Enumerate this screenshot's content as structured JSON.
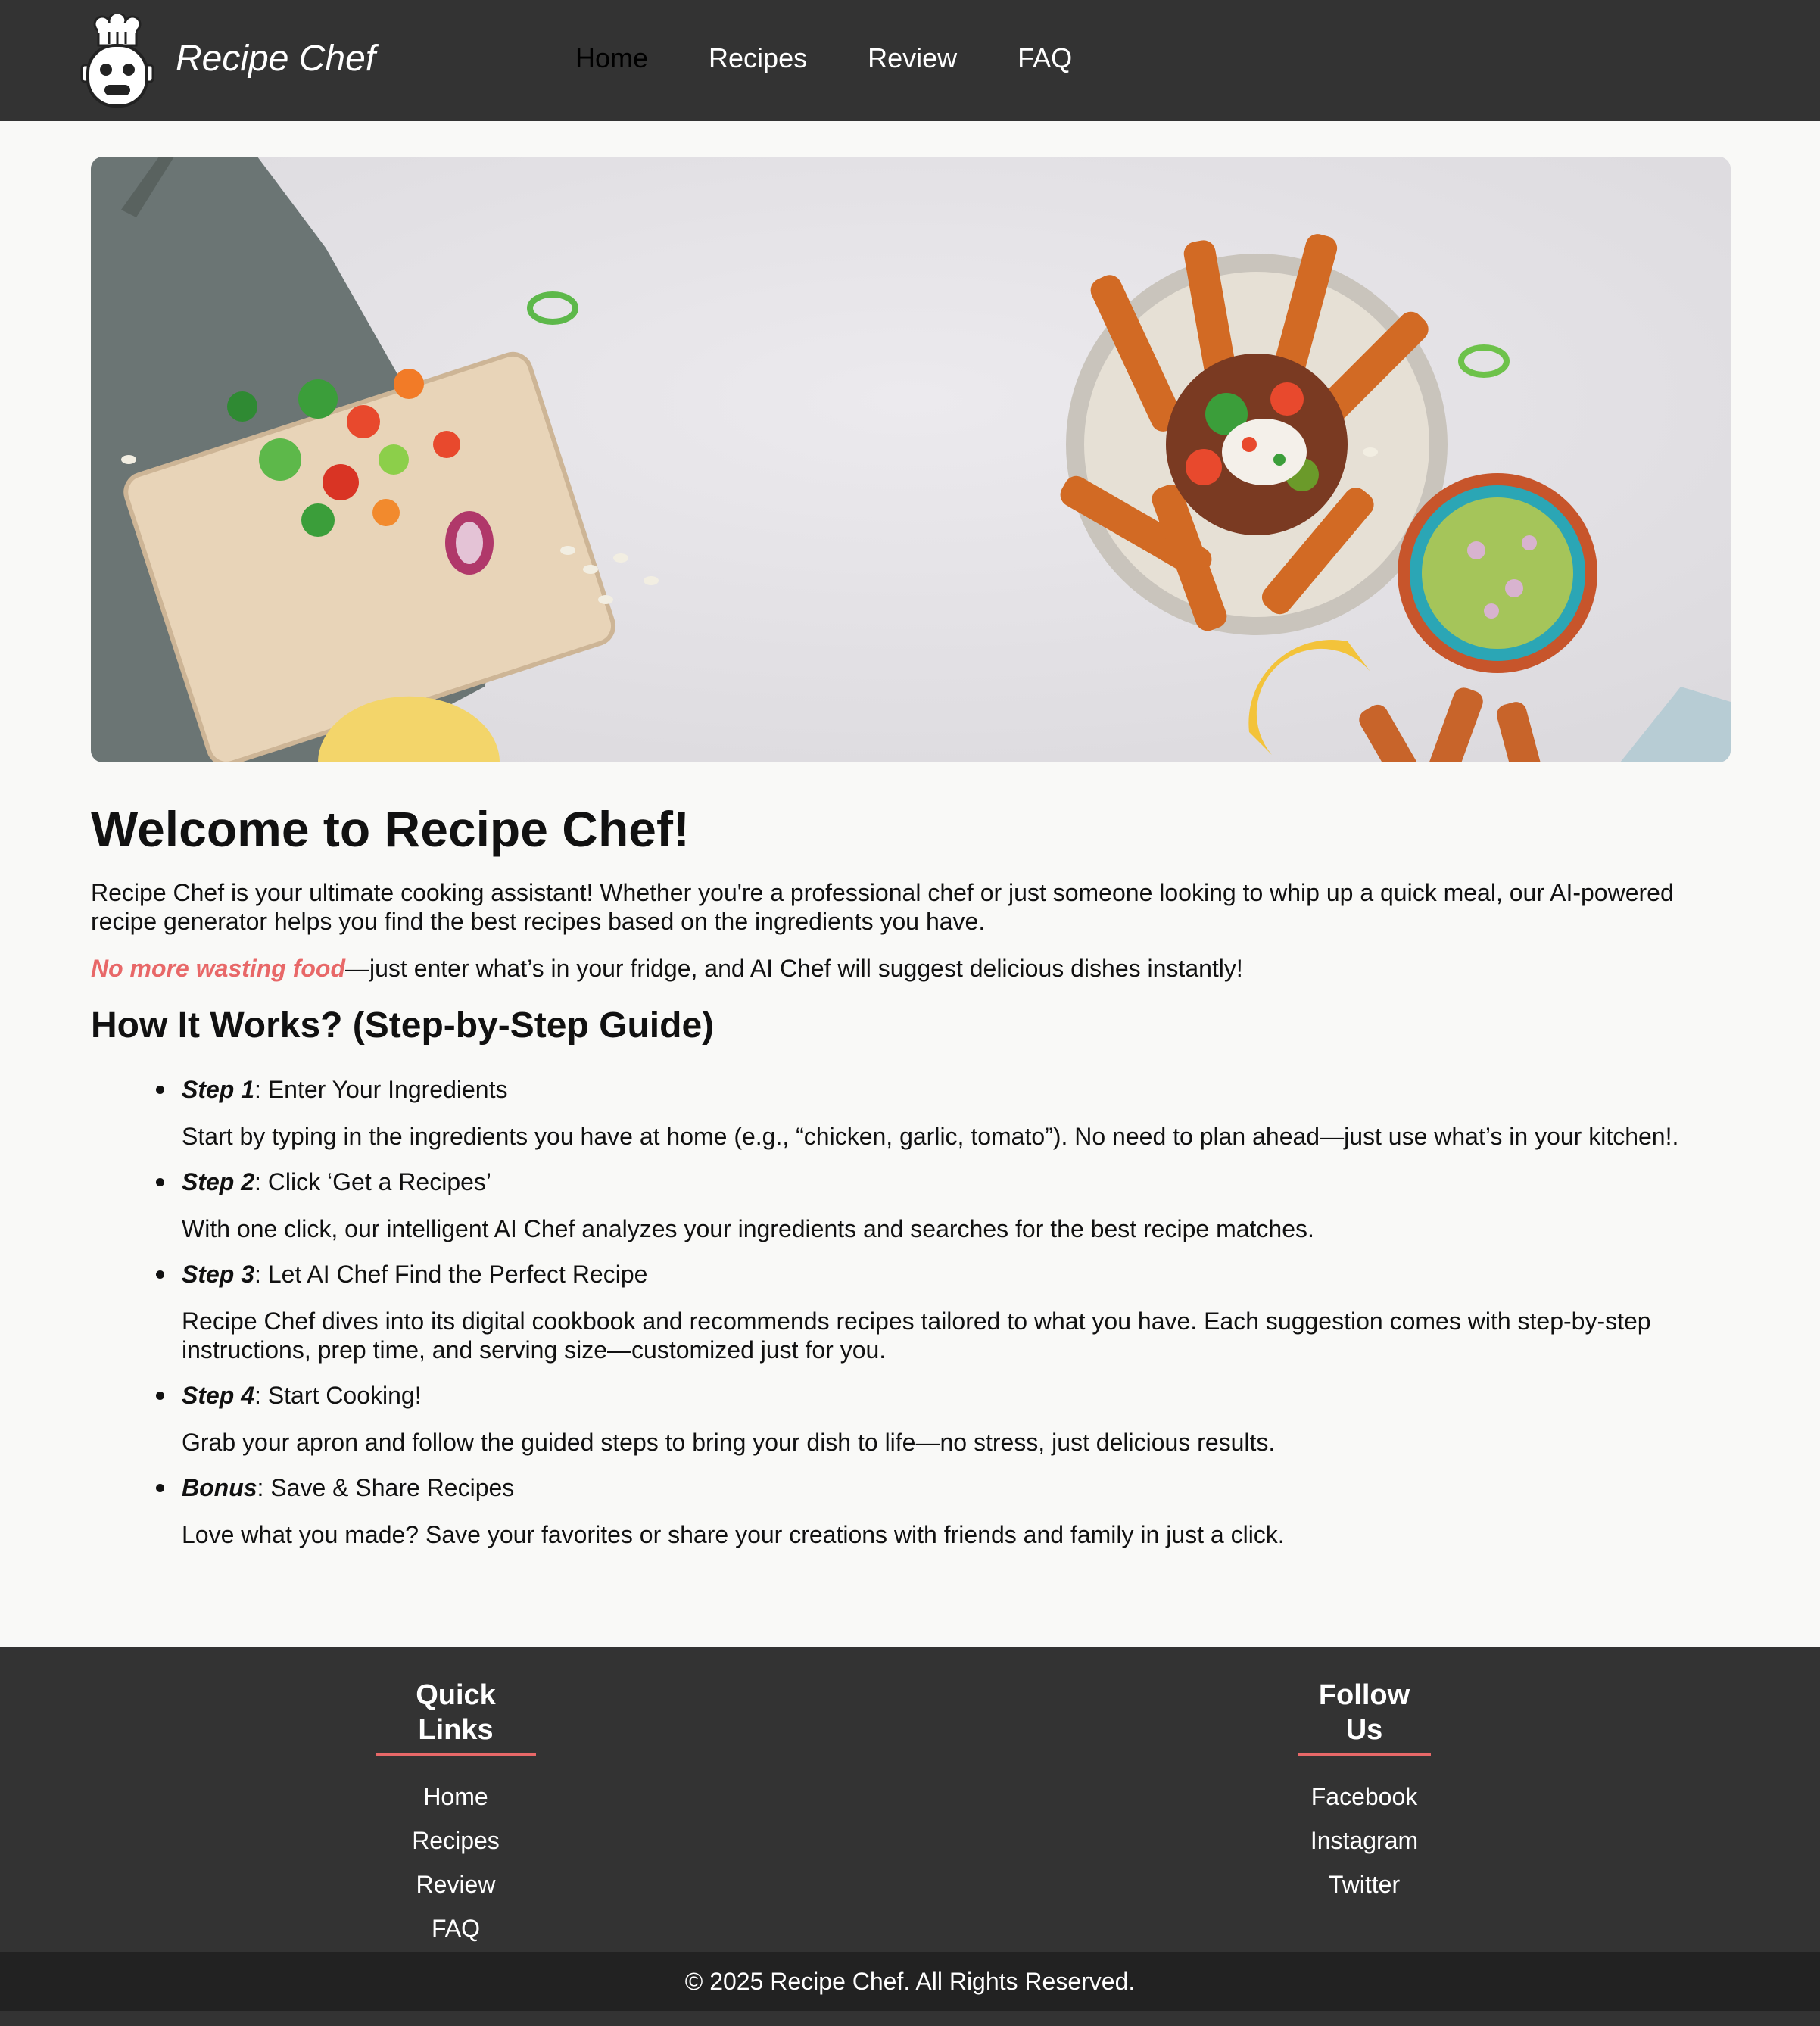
{
  "header": {
    "brand": "Recipe Chef",
    "logo_icon": "chef-robot-icon",
    "nav": [
      {
        "label": "Home",
        "active": true
      },
      {
        "label": "Recipes",
        "active": false
      },
      {
        "label": "Review",
        "active": false
      },
      {
        "label": "FAQ",
        "active": false
      }
    ]
  },
  "hero": {
    "image": "food-spread-photo"
  },
  "main": {
    "title": "Welcome to Recipe Chef!",
    "intro": "Recipe Chef is your ultimate cooking assistant! Whether you're a professional chef or just someone looking to whip up a quick meal, our AI-powered recipe generator helps you find the best recipes based on the ingredients you have.",
    "highlight": "No more wasting food",
    "highlight_rest": "—just enter what’s in your fridge, and AI Chef will suggest delicious dishes instantly!",
    "how_title": "How It Works? (Step-by-Step Guide)",
    "steps": [
      {
        "label": "Step 1",
        "title": ": Enter Your Ingredients",
        "desc": "Start by typing in the ingredients you have at home (e.g., “chicken, garlic, tomato”). No need to plan ahead—just use what’s in your kitchen!."
      },
      {
        "label": "Step 2",
        "title": ": Click ‘Get a Recipes’",
        "desc": "With one click, our intelligent AI Chef analyzes your ingredients and searches for the best recipe matches."
      },
      {
        "label": "Step 3",
        "title": ": Let AI Chef Find the Perfect Recipe",
        "desc": "Recipe Chef dives into its digital cookbook and recommends recipes tailored to what you have. Each suggestion comes with step-by-step instructions, prep time, and serving size—customized just for you."
      },
      {
        "label": "Step 4",
        "title": ": Start Cooking!",
        "desc": "Grab your apron and follow the guided steps to bring your dish to life—no stress, just delicious results."
      },
      {
        "label": "Bonus",
        "title": ": Save & Share Recipes",
        "desc": "Love what you made? Save your favorites or share your creations with friends and family in just a click."
      }
    ]
  },
  "footer": {
    "quick_links_title": "Quick Links",
    "quick_links": [
      "Home",
      "Recipes",
      "Review",
      "FAQ"
    ],
    "follow_title": "Follow Us",
    "follow_links": [
      "Facebook",
      "Instagram",
      "Twitter"
    ],
    "copyright": "© 2025 Recipe Chef. All Rights Reserved."
  },
  "colors": {
    "header_bg": "#333333",
    "accent": "#e86868",
    "page_bg": "#f9f9f7",
    "copyright_bg": "#222222"
  }
}
